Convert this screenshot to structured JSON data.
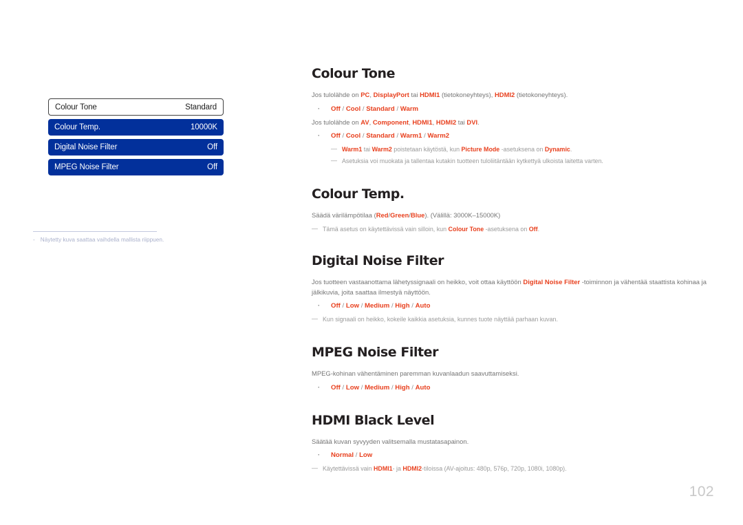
{
  "colors": {
    "osd_bar": "#02309b",
    "osd_selected_border": "#3f3f3f",
    "keyword_red": "#e8401e",
    "body_gray": "#757575",
    "note_gray": "#9a9a9a",
    "footnote_gray": "#a9b0cb",
    "page_number_gray": "#c9c9c9"
  },
  "osd_menu": {
    "rows": [
      {
        "label": "Colour Tone",
        "value": "Standard",
        "state": "selected"
      },
      {
        "label": "Colour Temp.",
        "value": "10000K",
        "state": "normal"
      },
      {
        "label": "Digital Noise Filter",
        "value": "Off",
        "state": "normal"
      },
      {
        "label": "MPEG Noise Filter",
        "value": "Off",
        "state": "normal"
      }
    ]
  },
  "left_footnote": {
    "dash": "-",
    "text": "Näytetty kuva saattaa vaihdella mallista riippuen."
  },
  "sections": [
    {
      "title": "Colour Tone",
      "para1_pre": "Jos tulolähde on ",
      "para1_kw1": "PC",
      "para1_mid1": ", ",
      "para1_kw2": "DisplayPort",
      "para1_mid2": " tai ",
      "para1_kw3": "HDMI1",
      "para1_mid3": " (tietokoneyhteys), ",
      "para1_kw4": "HDMI2",
      "para1_end": " (tietokoneyhteys).",
      "options1": [
        "Off",
        "Cool",
        "Standard",
        "Warm"
      ],
      "para2_pre": "Jos tulolähde on ",
      "para2_kw1": "AV",
      "para2_mid1": ", ",
      "para2_kw2": "Component",
      "para2_mid2": ", ",
      "para2_kw3": "HDMI1",
      "para2_mid3": ", ",
      "para2_kw4": "HDMI2",
      "para2_mid4": " tai ",
      "para2_kw5": "DVI",
      "para2_end": ".",
      "options2": [
        "Off",
        "Cool",
        "Standard",
        "Warm1",
        "Warm2"
      ],
      "note1_kw1": "Warm1",
      "note1_mid1": " tai ",
      "note1_kw2": "Warm2",
      "note1_mid2": " poistetaan käytöstä, kun ",
      "note1_kw3": "Picture Mode",
      "note1_mid3": " -asetuksena on ",
      "note1_kw4": "Dynamic",
      "note1_end": ".",
      "note2": "Asetuksia voi muokata ja tallentaa kutakin tuotteen tuloliitäntään kytkettyä ulkoista laitetta varten."
    },
    {
      "title": "Colour Temp.",
      "para_pre": "Säädä värilämpötilaa (",
      "para_kw1": "Red",
      "para_sep1": "/",
      "para_kw2": "Green",
      "para_sep2": "/",
      "para_kw3": "Blue",
      "para_end": "). (Välillä: 3000K–15000K)",
      "note_pre": "Tämä asetus on käytettävissä vain silloin, kun ",
      "note_kw1": "Colour Tone",
      "note_mid": " -asetuksena on ",
      "note_kw2": "Off",
      "note_end": "."
    },
    {
      "title": "Digital Noise Filter",
      "para_pre": "Jos tuotteen vastaanottama lähetyssignaali on heikko, voit ottaa käyttöön ",
      "para_kw": "Digital Noise Filter",
      "para_end": " -toiminnon ja vähentää staattista kohinaa ja jälkikuvia, joita saattaa ilmestyä näyttöön.",
      "options": [
        "Off",
        "Low",
        "Medium",
        "High",
        "Auto"
      ],
      "note": "Kun signaali on heikko, kokeile kaikkia asetuksia, kunnes tuote näyttää parhaan kuvan."
    },
    {
      "title": "MPEG Noise Filter",
      "para": "MPEG-kohinan vähentäminen paremman kuvanlaadun saavuttamiseksi.",
      "options": [
        "Off",
        "Low",
        "Medium",
        "High",
        "Auto"
      ]
    },
    {
      "title": "HDMI Black Level",
      "para": "Säätää kuvan syvyyden valitsemalla mustatasapainon.",
      "options": [
        "Normal",
        "Low"
      ],
      "note_pre": "Käytettävissä vain ",
      "note_kw1": "HDMI1",
      "note_mid1": "- ja ",
      "note_kw2": "HDMI2",
      "note_end": "-tiloissa (AV-ajoitus: 480p, 576p, 720p, 1080i, 1080p)."
    }
  ],
  "page_number": "102",
  "bullet_glyph": "·",
  "note_dash": "—"
}
